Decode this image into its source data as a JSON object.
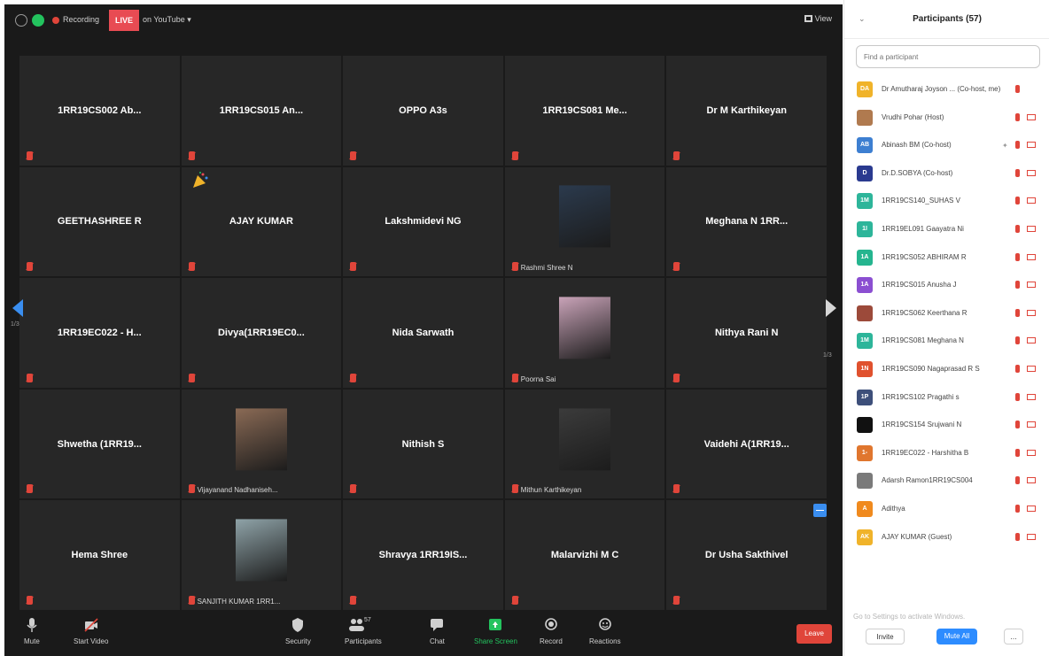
{
  "topbar": {
    "recording_label": "Recording",
    "live_label": "LIVE",
    "youtube_label": "on YouTube ▾",
    "view_label": "View"
  },
  "grid": {
    "prev_page": "1/3",
    "next_page": "1/3",
    "tiles": [
      {
        "name": "1RR19CS002 Ab...",
        "muted": true
      },
      {
        "name": "1RR19CS015 An...",
        "muted": true
      },
      {
        "name": "OPPO A3s",
        "muted": true
      },
      {
        "name": "1RR19CS081 Me...",
        "muted": true
      },
      {
        "name": "Dr M Karthikeyan",
        "muted": true
      },
      {
        "name": "GEETHASHREE R",
        "muted": true
      },
      {
        "name": "AJAY KUMAR",
        "muted": true,
        "party": true
      },
      {
        "name": "Lakshmidevi NG",
        "muted": true
      },
      {
        "name": "",
        "muted": true,
        "photo": "photo-avatar-1",
        "photo_color": "#2b3a4d",
        "bottom_name": "Rashmi Shree N"
      },
      {
        "name": "Meghana N 1RR...",
        "muted": true
      },
      {
        "name": "1RR19EC022 - H...",
        "muted": true
      },
      {
        "name": "Divya(1RR19EC0...",
        "muted": true
      },
      {
        "name": "Nida Sarwath",
        "muted": true
      },
      {
        "name": "",
        "muted": true,
        "photo": "photo-avatar-2",
        "photo_color": "#c9a3b8",
        "bottom_name": "Poorna Sai"
      },
      {
        "name": "Nithya Rani N",
        "muted": true
      },
      {
        "name": "Shwetha (1RR19...",
        "muted": true
      },
      {
        "name": "",
        "muted": true,
        "photo": "photo-avatar-3",
        "photo_color": "#8a6a55",
        "bottom_name": "Vijayanand Nadhaniseh..."
      },
      {
        "name": "Nithish S",
        "muted": true
      },
      {
        "name": "",
        "muted": true,
        "photo": "photo-avatar-4",
        "photo_color": "#3b3b3b",
        "bottom_name": "Mithun Karthikeyan"
      },
      {
        "name": "Vaidehi A(1RR19...",
        "muted": true
      },
      {
        "name": "Hema Shree",
        "muted": true
      },
      {
        "name": "",
        "muted": true,
        "photo": "photo-avatar-5",
        "photo_color": "#8fa3a8",
        "bottom_name": "SANJITH KUMAR 1RR1..."
      },
      {
        "name": "Shravya 1RR19IS...",
        "muted": true
      },
      {
        "name": "Malarvizhi M C",
        "muted": true
      },
      {
        "name": "Dr Usha Sakthivel",
        "muted": true
      }
    ]
  },
  "toolbar": {
    "mute": "Mute",
    "start_video": "Start Video",
    "security": "Security",
    "participants": "Participants",
    "participants_count": "57",
    "chat": "Chat",
    "share_screen": "Share Screen",
    "record": "Record",
    "reactions": "Reactions",
    "leave": "Leave"
  },
  "panel": {
    "title": "Participants (57)",
    "search_placeholder": "Find a participant",
    "participants": [
      {
        "initials": "DA",
        "color": "#f0b32a",
        "name": "Dr Amutharaj Joyson ... (Co-host, me)",
        "hand": "",
        "camera": false
      },
      {
        "initials": "",
        "color": "#b07a4f",
        "name": "Vrudhi Pohar (Host)",
        "hand": "",
        "camera": true
      },
      {
        "initials": "AB",
        "color": "#3d7fd1",
        "name": "Abinash BM (Co-host)",
        "hand": "✦",
        "camera": true
      },
      {
        "initials": "D",
        "color": "#2a3a8f",
        "name": "Dr.D.SOBYA (Co-host)",
        "hand": "",
        "camera": true
      },
      {
        "initials": "1M",
        "color": "#2db59a",
        "name": "1RR19CS140_SUHAS V",
        "hand": "",
        "camera": true
      },
      {
        "initials": "1I",
        "color": "#2db59a",
        "name": "1RR19EL091 Gaayatra Ni",
        "hand": "",
        "camera": true
      },
      {
        "initials": "1A",
        "color": "#25b58f",
        "name": "1RR19CS052 ABHIRAM R",
        "hand": "",
        "camera": true
      },
      {
        "initials": "1A",
        "color": "#8b4fd1",
        "name": "1RR19CS015 Anusha J",
        "hand": "",
        "camera": true
      },
      {
        "initials": "",
        "color": "#9c4a3a",
        "name": "1RR19CS062 Keerthana R",
        "hand": "",
        "camera": true
      },
      {
        "initials": "1M",
        "color": "#2db59a",
        "name": "1RR19CS081 Meghana N",
        "hand": "",
        "camera": true
      },
      {
        "initials": "1N",
        "color": "#e0512e",
        "name": "1RR19CS090 Nagaprasad R S",
        "hand": "",
        "camera": true
      },
      {
        "initials": "1P",
        "color": "#3d4f7a",
        "name": "1RR19CS102 Pragathi s",
        "hand": "",
        "camera": true
      },
      {
        "initials": "",
        "color": "#111111",
        "name": "1RR19CS154 Srujwani N",
        "hand": "",
        "camera": true
      },
      {
        "initials": "1-",
        "color": "#e0762e",
        "name": "1RR19EC022 - Harshitha B",
        "hand": "",
        "camera": true
      },
      {
        "initials": "",
        "color": "#7a7a7a",
        "name": "Adarsh Ramon1RR19CS004",
        "hand": "",
        "camera": true
      },
      {
        "initials": "A",
        "color": "#f08a1e",
        "name": "Adithya",
        "hand": "",
        "camera": true
      },
      {
        "initials": "AK",
        "color": "#f0b32a",
        "name": "AJAY KUMAR (Guest)",
        "hand": "",
        "camera": true
      }
    ],
    "footer_hint": "Go to Settings to activate Windows.",
    "invite": "Invite",
    "mute_all": "Mute All",
    "more": "..."
  }
}
